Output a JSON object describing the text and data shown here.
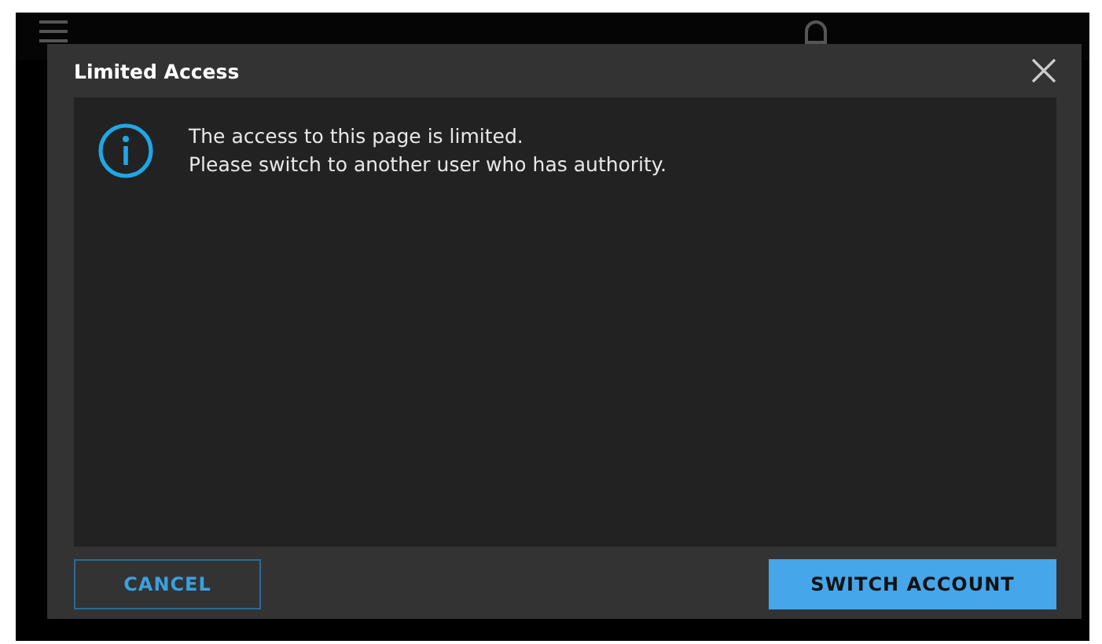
{
  "dialog": {
    "title": "Limited Access",
    "message_lines": [
      "The access to this page is limited.",
      "Please switch to another user who has authority."
    ],
    "buttons": [
      {
        "label": "CANCEL",
        "kind": "secondary"
      },
      {
        "label": "SWITCH ACCOUNT",
        "kind": "primary"
      }
    ]
  }
}
